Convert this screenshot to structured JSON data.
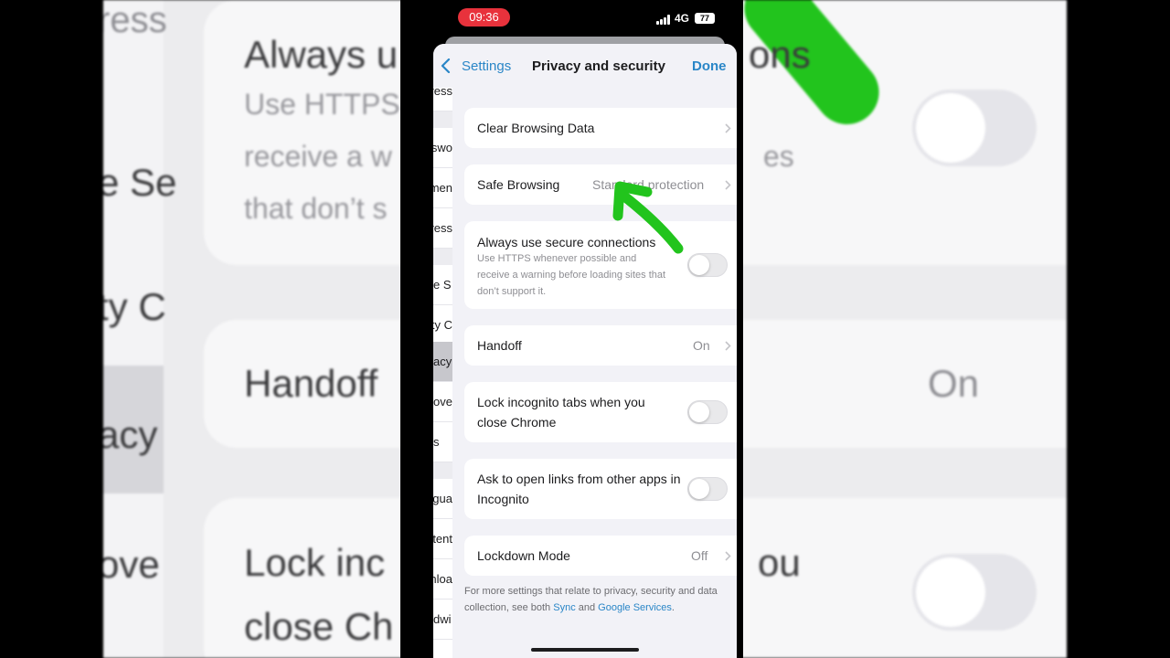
{
  "status_bar": {
    "time": "09:36",
    "network": "4G",
    "battery": "77"
  },
  "nav": {
    "back_label": "Settings",
    "title": "Privacy and security",
    "done_label": "Done"
  },
  "under_list": {
    "rows": [
      "ress",
      "swo",
      "men",
      "ress",
      "e S",
      "ty C",
      "acy",
      "ove",
      "s",
      "gua",
      "tent",
      "nloa",
      "dwi"
    ]
  },
  "rows": {
    "clear_browsing": {
      "label": "Clear Browsing Data"
    },
    "safe_browsing": {
      "label": "Safe Browsing",
      "value": "Standard protection"
    },
    "secure_connections": {
      "label": "Always use secure connections",
      "description": "Use HTTPS whenever possible and receive a warning before loading sites that don’t support it.",
      "enabled": false
    },
    "handoff": {
      "label": "Handoff",
      "value": "On"
    },
    "lock_incognito": {
      "label": "Lock incognito tabs when you close Chrome",
      "enabled": false
    },
    "open_links_incognito": {
      "label": "Ask to open links from other apps in Incognito",
      "enabled": false
    },
    "lockdown": {
      "label": "Lockdown Mode",
      "value": "Off"
    }
  },
  "footer": {
    "text_before": "For more settings that relate to privacy, security and data collection, see both ",
    "sync_link": "Sync",
    "and_text": " and ",
    "google_services_link": "Google Services",
    "end_text": "."
  },
  "background": {
    "secure_title": "Always u",
    "secure_title_right": "ons",
    "secure_sub": [
      "Use HTTPS",
      "receive a w",
      "that don’t s"
    ],
    "secure_sub_right": "es",
    "side_texts": [
      "ress",
      "e Se",
      "ty C",
      "acy",
      "ove"
    ],
    "handoff_title": "Handoff",
    "handoff_value": "On",
    "lock_title": [
      "Lock inc",
      "close Ch"
    ],
    "lock_title_right": "ou"
  },
  "colors": {
    "accent": "#2a86c7",
    "annotation_arrow": "#22c41d",
    "time_pill": "#e8323c"
  }
}
